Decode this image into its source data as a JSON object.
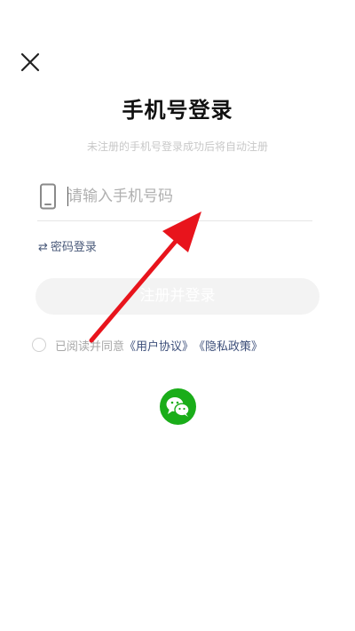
{
  "header": {
    "close_icon": "close-icon"
  },
  "login": {
    "title": "手机号登录",
    "subtitle": "未注册的手机号登录成功后将自动注册",
    "phone_placeholder": "请输入手机号码",
    "phone_icon": "phone-icon",
    "password_login_icon": "⇄",
    "password_login_label": "密码登录",
    "submit_label": "注册并登录"
  },
  "agreement": {
    "prefix": "已阅读并同意",
    "user_agreement": "《用户协议》",
    "privacy_policy": "《隐私政策》"
  },
  "third_party": {
    "wechat_icon": "wechat-icon"
  },
  "colors": {
    "wechat_green": "#1aad19",
    "link_blue": "#3d4f7a",
    "annotation_red": "#e8141c",
    "button_disabled_bg": "#f3f3f3"
  }
}
